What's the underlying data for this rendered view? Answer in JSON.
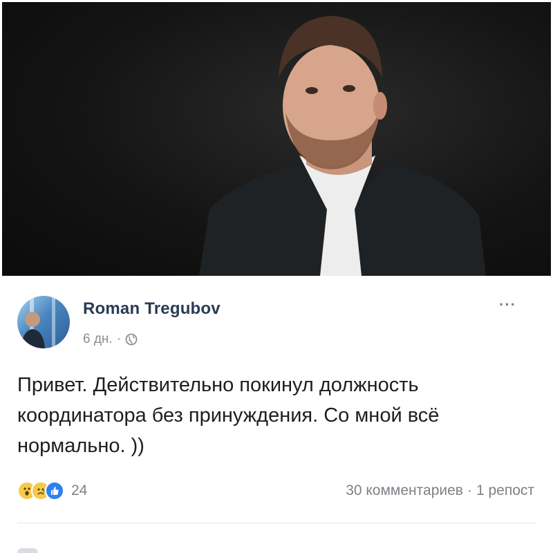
{
  "post": {
    "author": "Roman Tregubov",
    "time": "6 дн.",
    "separator": "·",
    "text": "Привет. Действительно покинул должность координатора без принуждения. Со мной всё нормально. ))",
    "more": "···",
    "reactions": {
      "icons": [
        "wow-reaction-icon",
        "sad-reaction-icon",
        "like-reaction-icon"
      ],
      "count": "24"
    },
    "comments": "30 комментариев",
    "stats_separator": "·",
    "shares": "1 репост"
  },
  "colors": {
    "author": "#2a3a55",
    "meta": "#8a8d91",
    "like": "#2f80ed",
    "emoji": "#f7c94a"
  }
}
